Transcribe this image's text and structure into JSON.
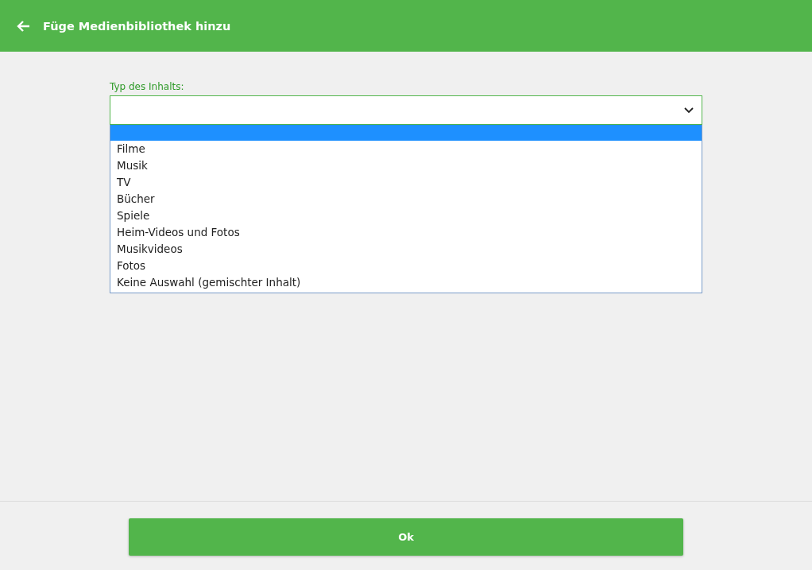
{
  "header": {
    "title": "Füge Medienbibliothek hinzu"
  },
  "form": {
    "label": "Typ des Inhalts:",
    "dropdown": {
      "expanded": true,
      "options": [
        {
          "selected": true
        },
        {
          "label": "Filme",
          "selected": false
        },
        {
          "label": "Musik",
          "selected": false
        },
        {
          "label": "TV",
          "selected": false
        },
        {
          "label": "Bücher",
          "selected": false
        },
        {
          "label": "Spiele",
          "selected": false
        },
        {
          "label": "Heim-Videos und Fotos",
          "selected": false
        },
        {
          "label": "Musikvideos",
          "selected": false
        },
        {
          "label": "Fotos",
          "selected": false
        },
        {
          "label": "Keine Auswahl (gemischter Inhalt)",
          "selected": false
        }
      ]
    }
  },
  "footer": {
    "button": "Ok"
  }
}
